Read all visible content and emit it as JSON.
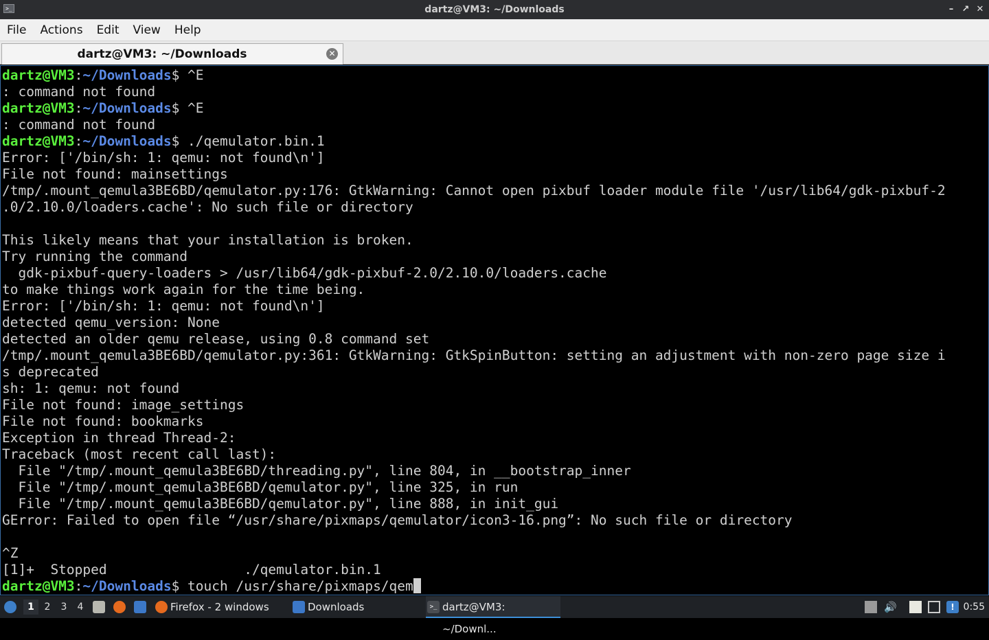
{
  "window": {
    "title": "dartz@VM3: ~/Downloads",
    "controls": [
      "minimize",
      "maximize",
      "close"
    ]
  },
  "menu": [
    "File",
    "Actions",
    "Edit",
    "View",
    "Help"
  ],
  "tab": {
    "label": "dartz@VM3: ~/Downloads",
    "close_icon": "close-icon"
  },
  "terminal": {
    "prompt_user": "dartz@VM3",
    "prompt_sep": ":",
    "prompt_path": "~/Downloads",
    "prompt_end": "$ ",
    "lines": [
      {
        "type": "prompt",
        "cmd": "^E"
      },
      {
        "type": "out",
        "text": ": command not found"
      },
      {
        "type": "prompt",
        "cmd": "^E"
      },
      {
        "type": "out",
        "text": ": command not found"
      },
      {
        "type": "prompt",
        "cmd": "./qemulator.bin.1"
      },
      {
        "type": "out",
        "text": "Error: ['/bin/sh: 1: qemu: not found\\n']"
      },
      {
        "type": "out",
        "text": "File not found: mainsettings"
      },
      {
        "type": "out",
        "text": "/tmp/.mount_qemula3BE6BD/qemulator.py:176: GtkWarning: Cannot open pixbuf loader module file '/usr/lib64/gdk-pixbuf-2"
      },
      {
        "type": "out",
        "text": ".0/2.10.0/loaders.cache': No such file or directory"
      },
      {
        "type": "out",
        "text": ""
      },
      {
        "type": "out",
        "text": "This likely means that your installation is broken."
      },
      {
        "type": "out",
        "text": "Try running the command"
      },
      {
        "type": "out",
        "text": "  gdk-pixbuf-query-loaders > /usr/lib64/gdk-pixbuf-2.0/2.10.0/loaders.cache"
      },
      {
        "type": "out",
        "text": "to make things work again for the time being."
      },
      {
        "type": "out",
        "text": "Error: ['/bin/sh: 1: qemu: not found\\n']"
      },
      {
        "type": "out",
        "text": "detected qemu_version: None"
      },
      {
        "type": "out",
        "text": "detected an older qemu release, using 0.8 command set"
      },
      {
        "type": "out",
        "text": "/tmp/.mount_qemula3BE6BD/qemulator.py:361: GtkWarning: GtkSpinButton: setting an adjustment with non-zero page size i"
      },
      {
        "type": "out",
        "text": "s deprecated"
      },
      {
        "type": "out",
        "text": "sh: 1: qemu: not found"
      },
      {
        "type": "out",
        "text": "File not found: image_settings"
      },
      {
        "type": "out",
        "text": "File not found: bookmarks"
      },
      {
        "type": "out",
        "text": "Exception in thread Thread-2:"
      },
      {
        "type": "out",
        "text": "Traceback (most recent call last):"
      },
      {
        "type": "out",
        "text": "  File \"/tmp/.mount_qemula3BE6BD/threading.py\", line 804, in __bootstrap_inner"
      },
      {
        "type": "out",
        "text": "  File \"/tmp/.mount_qemula3BE6BD/qemulator.py\", line 325, in run"
      },
      {
        "type": "out",
        "text": "  File \"/tmp/.mount_qemula3BE6BD/qemulator.py\", line 888, in init_gui"
      },
      {
        "type": "out",
        "text": "GError: Failed to open file “/usr/share/pixmaps/qemulator/icon3-16.png”: No such file or directory"
      },
      {
        "type": "out",
        "text": ""
      },
      {
        "type": "out",
        "text": "^Z"
      },
      {
        "type": "out",
        "text": "[1]+  Stopped                 ./qemulator.bin.1"
      },
      {
        "type": "prompt",
        "cmd": "touch /usr/share/pixmaps/qem",
        "cursor": true
      }
    ]
  },
  "taskbar": {
    "start_icon": "start-menu-icon",
    "workspaces": [
      "1",
      "2",
      "3",
      "4"
    ],
    "active_workspace": "1",
    "launchers": [
      "file-manager-icon",
      "firefox-icon",
      "folder-icon"
    ],
    "tasks": [
      {
        "label": "Firefox - 2 windows",
        "icon": "firefox-icon",
        "active": false
      },
      {
        "label": "Downloads",
        "icon": "folder-icon",
        "active": false
      },
      {
        "label": "dartz@VM3: ~/Downl...",
        "icon": "terminal-icon",
        "active": true
      }
    ],
    "tray": [
      "removable-drive-icon",
      "volume-icon",
      "clipboard-icon",
      "network-icon",
      "notification-icon"
    ],
    "clock": "0:55"
  }
}
